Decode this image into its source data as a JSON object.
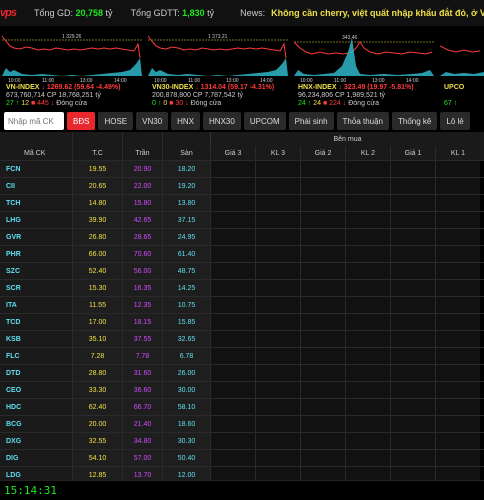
{
  "topbar": {
    "gd_label": "Tổng GD:",
    "gd_value": "20,758",
    "gd_unit": "tỷ",
    "gdtt_label": "Tổng GDTT:",
    "gdtt_value": "1,830",
    "gdtt_unit": "tỷ",
    "news_label": "News:",
    "news_text": "Không cần cherry, việt quất nhập khẩu đắt đỏ, ở Việt Nam có"
  },
  "indices": [
    {
      "name": "VN-INDEX",
      "value": "1269.62",
      "change": "(59.64 -4.49%)",
      "volume": "673,760,714 CP 18,768,251 tỷ",
      "up": "27",
      "ref": "12",
      "down": "445",
      "status": "Đóng cửa",
      "ref_line": "1 329.26"
    },
    {
      "name": "VN30-INDEX",
      "value": "1314.04",
      "change": "(59.17 -4.31%)",
      "volume": "200,878,800 CP 7,787,542 tỷ",
      "up": "0",
      "ref": "0",
      "down": "30",
      "status": "Đóng cửa",
      "ref_line": "1 373.21"
    },
    {
      "name": "HNX-INDEX",
      "value": "323.49",
      "change": "(19.97 -5.81%)",
      "volume": "96,234,806 CP 1,989,521 tỷ",
      "up": "24",
      "ref": "24",
      "down": "224",
      "status": "Đóng cửa",
      "ref_line": "343.46"
    },
    {
      "name": "UPCO",
      "value": "",
      "change": "",
      "volume": "",
      "up": "67",
      "ref": "",
      "down": "",
      "status": "",
      "ref_line": ""
    }
  ],
  "chart_data": {
    "type": "area",
    "times": [
      "10:00",
      "11:00",
      "13:00",
      "14:00"
    ]
  },
  "toolbar": {
    "search_placeholder": "Nhập mã CK",
    "tabs": [
      "BĐS",
      "HOSE",
      "VN30",
      "HNX",
      "HNX30",
      "UPCOM",
      "Phái sinh",
      "Thỏa thuận",
      "Thống kê",
      "Lô lẻ"
    ]
  },
  "table": {
    "group_label": "Bên mua",
    "headers": [
      "Mã CK",
      "T.C",
      "Trần",
      "Sàn",
      "Giá 3",
      "KL 3",
      "Giá 2",
      "KL 2",
      "Giá 1",
      "KL 1"
    ],
    "rows": [
      [
        "FCN",
        "19.55",
        "20.90",
        "18.20"
      ],
      [
        "CII",
        "20.65",
        "22.00",
        "19.20"
      ],
      [
        "TCH",
        "14.80",
        "15.80",
        "13.80"
      ],
      [
        "LHG",
        "39.90",
        "42.65",
        "37.15"
      ],
      [
        "GVR",
        "26.80",
        "28.65",
        "24.95"
      ],
      [
        "PHR",
        "66.00",
        "70.60",
        "61.40"
      ],
      [
        "SZC",
        "52.40",
        "56.00",
        "48.75"
      ],
      [
        "SCR",
        "15.30",
        "16.35",
        "14.25"
      ],
      [
        "ITA",
        "11.55",
        "12.35",
        "10.75"
      ],
      [
        "TCD",
        "17.00",
        "18.15",
        "15.85"
      ],
      [
        "KSB",
        "35.10",
        "37.55",
        "32.65"
      ],
      [
        "FLC",
        "7.28",
        "7.78",
        "6.78"
      ],
      [
        "DTD",
        "28.80",
        "31.60",
        "26.00"
      ],
      [
        "CEO",
        "33.30",
        "36.60",
        "30.00"
      ],
      [
        "HDC",
        "62.40",
        "66.70",
        "58.10"
      ],
      [
        "BCG",
        "20.00",
        "21.40",
        "18.60"
      ],
      [
        "DXG",
        "32.55",
        "34.80",
        "30.30"
      ],
      [
        "DIG",
        "54.10",
        "57.00",
        "50.40"
      ],
      [
        "LDG",
        "12.85",
        "13.70",
        "12.00"
      ]
    ]
  },
  "clock": "15:14:31",
  "colors": {
    "up": "#1fe81f",
    "ref": "#f0e04a",
    "down": "#ff3b3b",
    "ceiling": "#d04cff",
    "floor": "#5ee0f0",
    "accent": "#e8282c"
  }
}
